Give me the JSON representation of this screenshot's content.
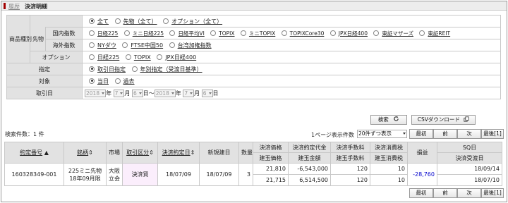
{
  "header": {
    "breadcrumb": "履歴",
    "title": "決済明細"
  },
  "conditions": {
    "product_label": "商品種別",
    "futures_label": "先物",
    "domestic_label": "国内指数",
    "overseas_label": "海外指数",
    "option_label": "オプション",
    "product_types": [
      "全て",
      "先物（全て）",
      "オプション（全て）"
    ],
    "domestic_items": [
      "日経225",
      "ミニ日経225",
      "日経平均VI",
      "TOPIX",
      "ミニTOPIX",
      "TOPIXCore30",
      "JPX日経400",
      "東証マザーズ",
      "東証REIT"
    ],
    "overseas_items": [
      "NYダウ",
      "FTSE中国50",
      "台湾加権指数"
    ],
    "option_items": [
      "日経225",
      "TOPIX",
      "JPX日経400"
    ],
    "designation_label": "指定",
    "designation_options": [
      "取引日指定",
      "年別指定（受渡日基準）"
    ],
    "target_label": "対象",
    "target_options": [
      "当日",
      "過去"
    ],
    "trade_date_label": "取引日",
    "date_from": {
      "year": "2018",
      "month": "7",
      "day": "6"
    },
    "date_to": {
      "year": "2018",
      "month": "7",
      "day": "6"
    },
    "unit_year": "年",
    "unit_month": "月",
    "unit_day": "日",
    "range_sep": "〜"
  },
  "actions": {
    "search": "検索",
    "csv": "CSVダウンロード"
  },
  "results": {
    "count_text": "検索件数：1 件",
    "per_page_label": "1ページ表示件数",
    "per_page_value": "20件ずつ表示",
    "pager": [
      "最初",
      "前",
      "次",
      "最後[1]"
    ],
    "headers": {
      "contract_no": "約定番号",
      "issue": "銘柄",
      "market": "市場",
      "trade_type": "取引区分",
      "settle_date": "決済約定日",
      "open_date": "新規建日",
      "qty": "数量",
      "settle_price": "決済価格",
      "open_price": "建玉価格",
      "settle_amount": "決済約定代金",
      "open_amount": "建玉金額",
      "settle_fee": "決済手数料",
      "open_fee": "建玉手数料",
      "settle_tax": "決済消費税",
      "open_tax": "建玉消費税",
      "pnl": "損益",
      "sq_date": "SQ日",
      "settle_delivery": "決済受渡日"
    },
    "rows": [
      {
        "contract_no": "160328349-001",
        "issue_line1": "225ミニ先物",
        "issue_line2": "18年09月限",
        "market_line1": "大阪",
        "market_line2": "立会",
        "trade_type": "決済買",
        "settle_date": "18/07/09",
        "open_date": "18/07/09",
        "qty": "3",
        "settle_price": "21,810",
        "open_price": "21,715",
        "settle_amount": "-6,543,000",
        "open_amount": "6,514,500",
        "settle_fee": "120",
        "open_fee": "120",
        "settle_tax": "10",
        "open_tax": "10",
        "pnl": "-28,760",
        "sq_date": "18/09/14",
        "settle_delivery": "18/07/10"
      }
    ]
  }
}
